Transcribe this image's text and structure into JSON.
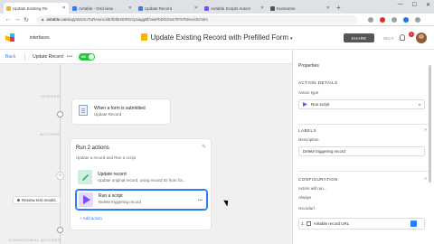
{
  "browser": {
    "tabs": [
      {
        "label": "Update Existing Re",
        "color": "#f4b400",
        "active": true
      },
      {
        "label": "Airtable - Grid view",
        "color": "#2d7ff9",
        "active": false
      },
      {
        "label": "Update Record",
        "color": "#2d7ff9",
        "active": false
      },
      {
        "label": "Airtable Scripts Autom",
        "color": "#7c4dff",
        "active": false
      },
      {
        "label": "Kunnonne",
        "color": "#555555",
        "active": false
      }
    ],
    "new_tab": "+",
    "url_domain": "airtable.com",
    "url_path": "/appWoXoTuRAwnrJiiE/tblbHEtRG2yaaggBf/viwPbDGDn47tF97Mrec/dc/mlm"
  },
  "header": {
    "workspace": "interfaces",
    "base_title": "Update Existing Record with Prefilled Form",
    "share_label": "SHARE",
    "help_label": "HELP",
    "badge_count": "1"
  },
  "toolbar": {
    "back_label": "Back",
    "automation_name": "Update Record",
    "toggle_label": "ON"
  },
  "canvas": {
    "trigger_step_label": "TRIGGER",
    "actions_step_label": "ACTIONS",
    "conditional_label": "CONDITIONAL ACTIONS",
    "trigger_title": "When a form is submitted",
    "trigger_subtitle": "Update Record",
    "actions_title": "Run 2 actions",
    "actions_subtitle": "Update a record and Run a script",
    "action1_title": "Update record",
    "action1_subtitle": "Update original record, using record ID from for...",
    "action2_title": "Run a script",
    "action2_subtitle": "Delete triggering record",
    "add_action": "+ Add action",
    "review_label": "Review test results"
  },
  "panel": {
    "title": "Properties",
    "action_details": "ACTION DETAILS",
    "action_type_label": "Action type",
    "action_type_value": "Run script",
    "labels_section": "LABELS",
    "description_label": "Description",
    "description_value": "Delete triggering record",
    "config_section": "CONFIGURATION",
    "action_run_label": "Action will run...",
    "action_run_value": "Always",
    "recordurl_label": "recordurl",
    "token_label": "Airtable record URL",
    "token_prefix": "1."
  }
}
